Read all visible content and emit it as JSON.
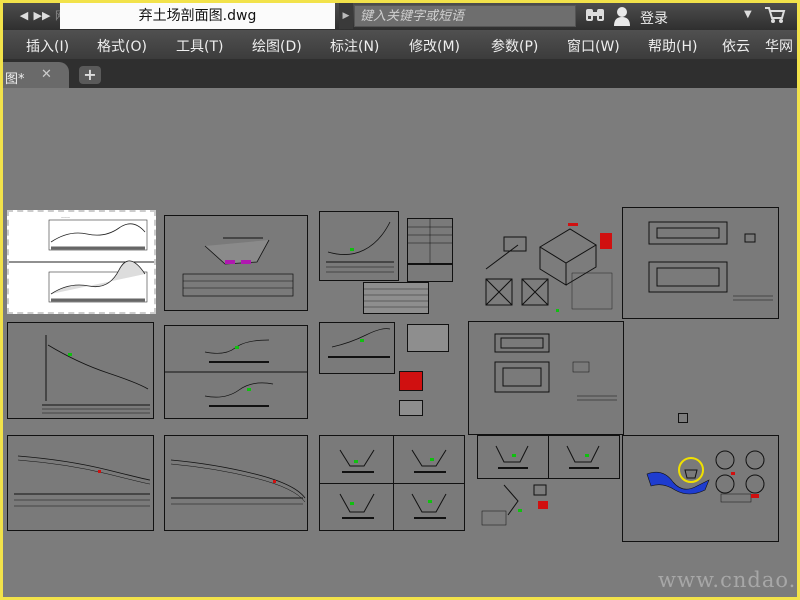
{
  "titlebar": {
    "quick_access": [
      "◀",
      "▶▶"
    ],
    "ghost_logo": "网",
    "document_title": "弃土场剖面图.dwg",
    "search_placeholder": "键入关键字或短语",
    "login_label": "登录"
  },
  "menu": {
    "items": [
      "插入(I)",
      "格式(O)",
      "工具(T)",
      "绘图(D)",
      "标注(N)",
      "修改(M)",
      "参数(P)",
      "窗口(W)",
      "帮助(H)",
      "依云",
      "华网"
    ]
  },
  "tabs": {
    "active_label": "图*",
    "close_glyph": "✕",
    "add_glyph": "+"
  },
  "watermark": "www.cndao.com",
  "colors": {
    "border": "#f2e24a",
    "canvas": "#7b7b7b",
    "sheet_line": "#111111",
    "accent_red": "#d01010",
    "accent_green": "#10c010",
    "accent_blue": "#1e3ccf"
  }
}
